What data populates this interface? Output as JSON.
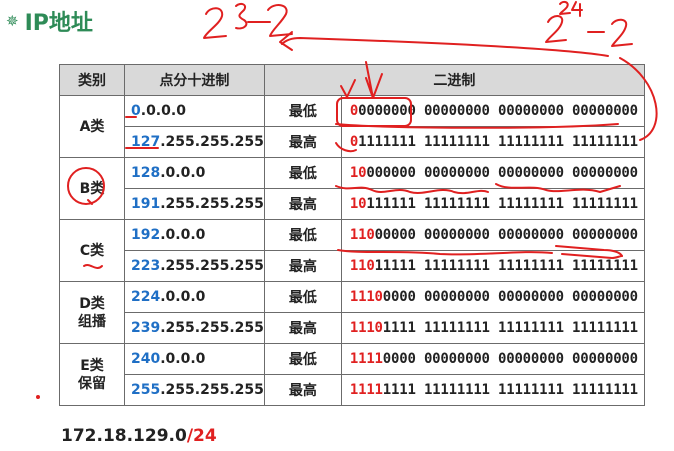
{
  "title": {
    "icon": "gear-icon",
    "text": "IP地址"
  },
  "headers": {
    "cls": "类别",
    "ip": "点分十进制",
    "bin": "二进制"
  },
  "classes": [
    {
      "name": "A类",
      "sub": "",
      "rows": [
        {
          "ip_net": "0",
          "ip_rest": ".0.0.0",
          "level": "最低",
          "bin_net": "0",
          "bin_rest": "0000000 00000000 00000000 00000000"
        },
        {
          "ip_net": "127",
          "ip_rest": ".255.255.255",
          "level": "最高",
          "bin_net": "0",
          "bin_rest": "1111111 11111111 11111111 11111111"
        }
      ]
    },
    {
      "name": "B类",
      "sub": "",
      "rows": [
        {
          "ip_net": "128",
          "ip_rest": ".0.0.0",
          "level": "最低",
          "bin_net": "10",
          "bin_rest": "000000 00000000 00000000 00000000"
        },
        {
          "ip_net": "191",
          "ip_rest": ".255.255.255",
          "level": "最高",
          "bin_net": "10",
          "bin_rest": "111111 11111111 11111111 11111111"
        }
      ]
    },
    {
      "name": "C类",
      "sub": "",
      "rows": [
        {
          "ip_net": "192",
          "ip_rest": ".0.0.0",
          "level": "最低",
          "bin_net": "110",
          "bin_rest": "00000 00000000 00000000 00000000"
        },
        {
          "ip_net": "223",
          "ip_rest": ".255.255.255",
          "level": "最高",
          "bin_net": "110",
          "bin_rest": "11111 11111111 11111111 11111111"
        }
      ]
    },
    {
      "name": "D类",
      "sub": "组播",
      "rows": [
        {
          "ip_net": "224",
          "ip_rest": ".0.0.0",
          "level": "最低",
          "bin_net": "1110",
          "bin_rest": "0000 00000000 00000000 00000000"
        },
        {
          "ip_net": "239",
          "ip_rest": ".255.255.255",
          "level": "最高",
          "bin_net": "1110",
          "bin_rest": "1111 11111111 11111111 11111111"
        }
      ]
    },
    {
      "name": "E类",
      "sub": "保留",
      "rows": [
        {
          "ip_net": "240",
          "ip_rest": ".0.0.0",
          "level": "最低",
          "bin_net": "1111",
          "bin_rest": "0000 00000000 00000000 00000000"
        },
        {
          "ip_net": "255",
          "ip_rest": ".255.255.255",
          "level": "最高",
          "bin_net": "1111",
          "bin_rest": "1111 11111111 11111111 11111111"
        }
      ]
    }
  ],
  "footer": {
    "addr": "172.18.129.0",
    "mask": "/24"
  },
  "colors": {
    "network": "#1f6fc5",
    "accent": "#e02020",
    "title": "#2e8b57",
    "header_bg": "#d9d9d9"
  }
}
